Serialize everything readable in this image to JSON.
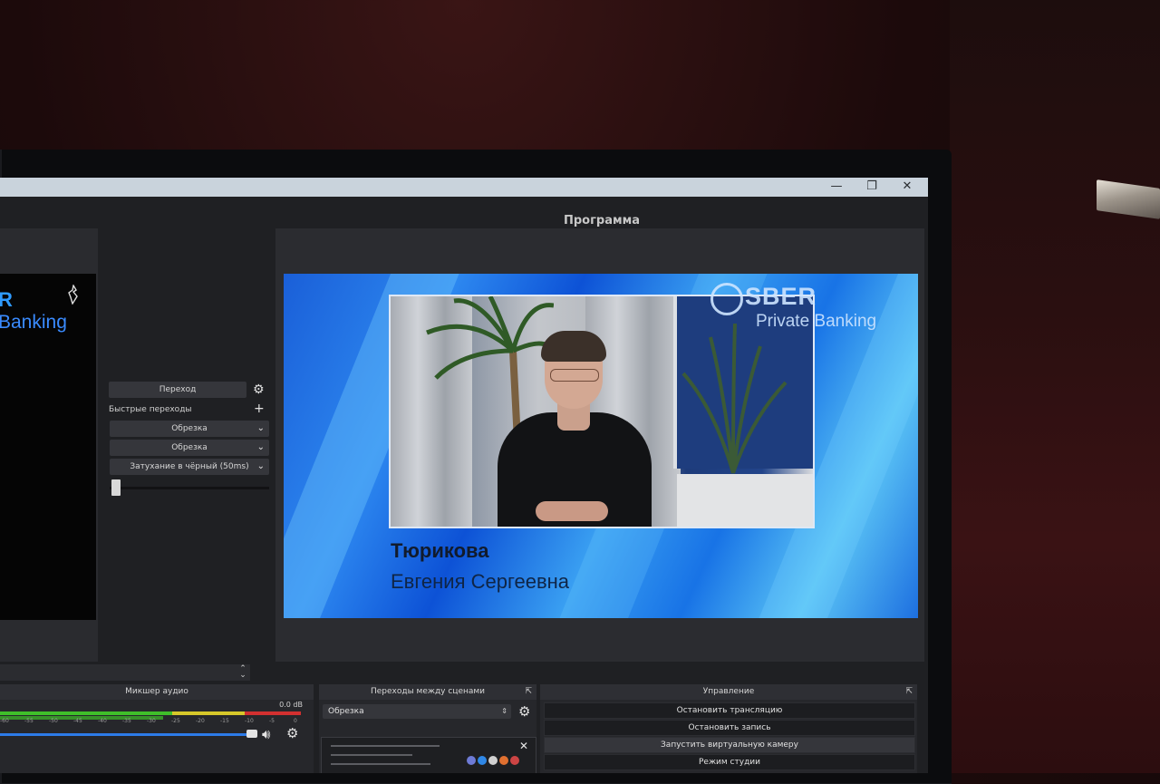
{
  "window": {
    "minimize_glyph": "—",
    "restore_glyph": "❐",
    "close_glyph": "✕"
  },
  "program": {
    "title": "Программа",
    "brand_name": "SBER",
    "brand_sub": "Private Banking",
    "lower_third": {
      "surname": "Тюрикова",
      "given_names": "Евгения Сергеевна"
    }
  },
  "preview": {
    "brand_fragment": "R",
    "banking_fragment": "Banking"
  },
  "transitions_panel": {
    "transition_button": "Переход",
    "quick_transitions_label": "Быстрые переходы",
    "quick_items": [
      "Обрезка",
      "Обрезка",
      "Затухание в чёрный (50ms)"
    ]
  },
  "docks": {
    "audio_mixer": {
      "title": "Микшер аудио",
      "db_top": "0.0 dB",
      "db_ticks": [
        "-60",
        "-55",
        "-50",
        "-45",
        "-40",
        "-35",
        "-30",
        "-25",
        "-20",
        "-15",
        "-10",
        "-5",
        "0"
      ]
    },
    "scene_transitions": {
      "title": "Переходы между сценами",
      "selected": "Обрезка"
    },
    "controls": {
      "title": "Управление",
      "buttons": [
        "Остановить трансляцию",
        "Остановить запись",
        "Запустить виртуальную камеру",
        "Режим студии"
      ]
    }
  },
  "colors": {
    "accent_blue": "#2d7be8",
    "meter_green": "#3fbf2a",
    "meter_yellow": "#d6c72a",
    "meter_red": "#d23030"
  }
}
